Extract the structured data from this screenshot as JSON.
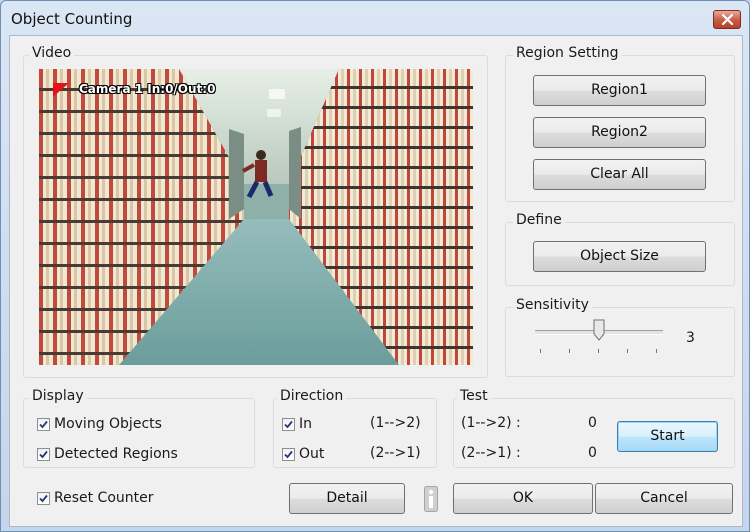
{
  "window": {
    "title": "Object Counting"
  },
  "video": {
    "legend": "Video",
    "overlay_text": "Camera 1 In:0/Out:0"
  },
  "region_setting": {
    "legend": "Region Setting",
    "buttons": [
      "Region1",
      "Region2",
      "Clear All"
    ]
  },
  "define": {
    "legend": "Define",
    "object_size_label": "Object Size"
  },
  "sensitivity": {
    "legend": "Sensitivity",
    "value": 3,
    "value_label": "3",
    "min": 1,
    "max": 5
  },
  "display": {
    "legend": "Display",
    "options": [
      {
        "label": "Moving Objects",
        "checked": true
      },
      {
        "label": "Detected Regions",
        "checked": true
      }
    ]
  },
  "direction": {
    "legend": "Direction",
    "options": [
      {
        "label": "In",
        "checked": true,
        "mapping": "(1-->2)"
      },
      {
        "label": "Out",
        "checked": true,
        "mapping": "(2-->1)"
      }
    ]
  },
  "test": {
    "legend": "Test",
    "rows": [
      {
        "label": "(1-->2) :",
        "count": "0"
      },
      {
        "label": "(2-->1) :",
        "count": "0"
      }
    ],
    "start_label": "Start"
  },
  "footer": {
    "reset_counter": {
      "label": "Reset Counter",
      "checked": true
    },
    "detail_label": "Detail",
    "ok_label": "OK",
    "cancel_label": "Cancel"
  },
  "icons": {
    "close": "close-icon",
    "info": "info-icon",
    "checkmark": "checkmark-icon",
    "camera_marker": "camera-marker-icon"
  },
  "colors": {
    "title_gradient_top": "#dbe6f4",
    "close_button": "#c85a44",
    "default_button": "#a7d9f5",
    "camera_marker": "#e4131b"
  }
}
